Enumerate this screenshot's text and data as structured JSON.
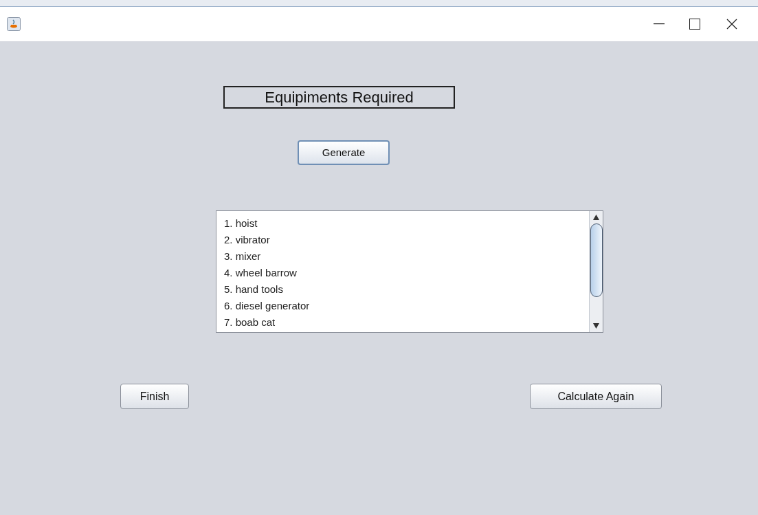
{
  "heading": "Equipiments Required",
  "generate_button": "Generate",
  "equipment_list": [
    "1. hoist",
    "2. vibrator",
    "3. mixer",
    "4. wheel barrow",
    "5. hand tools",
    "6. diesel generator",
    "7. boab cat"
  ],
  "buttons": [
    "Finish",
    "Calculate Again"
  ]
}
